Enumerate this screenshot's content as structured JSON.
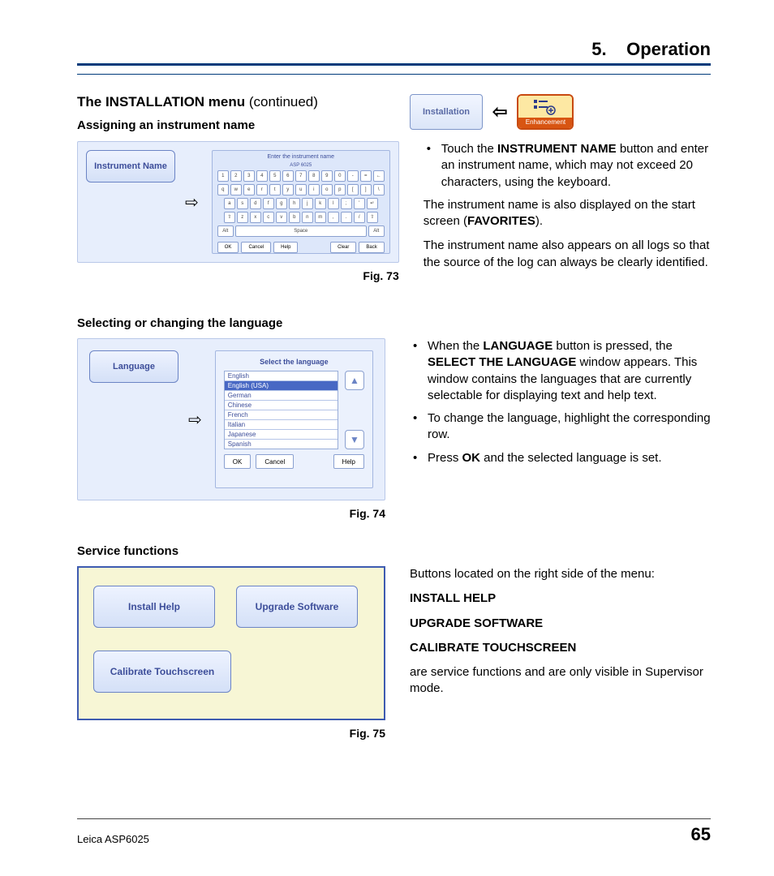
{
  "header": {
    "chapter_num": "5.",
    "chapter_title": "Operation"
  },
  "installation_menu": {
    "title": "The INSTALLATION menu",
    "continued": "(continued)"
  },
  "icon_row": {
    "installation_label": "Installation",
    "enhancement_label": "Enhancement"
  },
  "section1": {
    "title": "Assigning an instrument name",
    "button_label": "Instrument Name",
    "kbd_title": "Enter the instrument name",
    "kbd_sub": "ASP 6025",
    "kbd_space": "Space",
    "kbd_ok": "OK",
    "kbd_cancel": "Cancel",
    "kbd_help": "Help",
    "kbd_clear": "Clear",
    "kbd_back": "Back",
    "caption": "Fig. 73",
    "text": {
      "bullet1_pre": "Touch the ",
      "bullet1_bold": "INSTRUMENT NAME",
      "bullet1_post": " button and enter an instrument name, which may not exceed 20 characters, using the keyboard.",
      "p2_pre": "The instrument name is also displayed on the start screen (",
      "p2_bold": "FAVORITES",
      "p2_post": ").",
      "p3": "The instrument name also appears on all logs so that the source of the log can always be clearly identified."
    }
  },
  "section2": {
    "title": "Selecting or changing the language",
    "button_label": "Language",
    "panel_title": "Select the language",
    "languages": [
      "English",
      "English (USA)",
      "German",
      "Chinese",
      "French",
      "Italian",
      "Japanese",
      "Spanish"
    ],
    "selected_index": 1,
    "ok": "OK",
    "cancel": "Cancel",
    "help": "Help",
    "caption": "Fig. 74",
    "text": {
      "b1_pre": "When the ",
      "b1_bold1": "LANGUAGE",
      "b1_mid": " button is pressed, the ",
      "b1_bold2": "SELECT THE LANGUAGE",
      "b1_post": " window appears. This window contains the languages that are currently selectable for displaying text and help text.",
      "b2": "To change the language, highlight the corresponding row.",
      "b3_pre": "Press ",
      "b3_bold": "OK",
      "b3_post": " and the selected language is set."
    }
  },
  "section3": {
    "title": "Service functions",
    "btn1": "Install Help",
    "btn2": "Upgrade Software",
    "btn3": "Calibrate Touchscreen",
    "caption": "Fig. 75",
    "text": {
      "p1": "Buttons located on the right side of the menu:",
      "l1": "INSTALL HELP",
      "l2": "UPGRADE SOFTWARE",
      "l3": "CALIBRATE TOUCHSCREEN",
      "p2": "are service functions and are only visible in Supervisor mode."
    }
  },
  "footer": {
    "product": "Leica ASP6025",
    "page": "65"
  }
}
